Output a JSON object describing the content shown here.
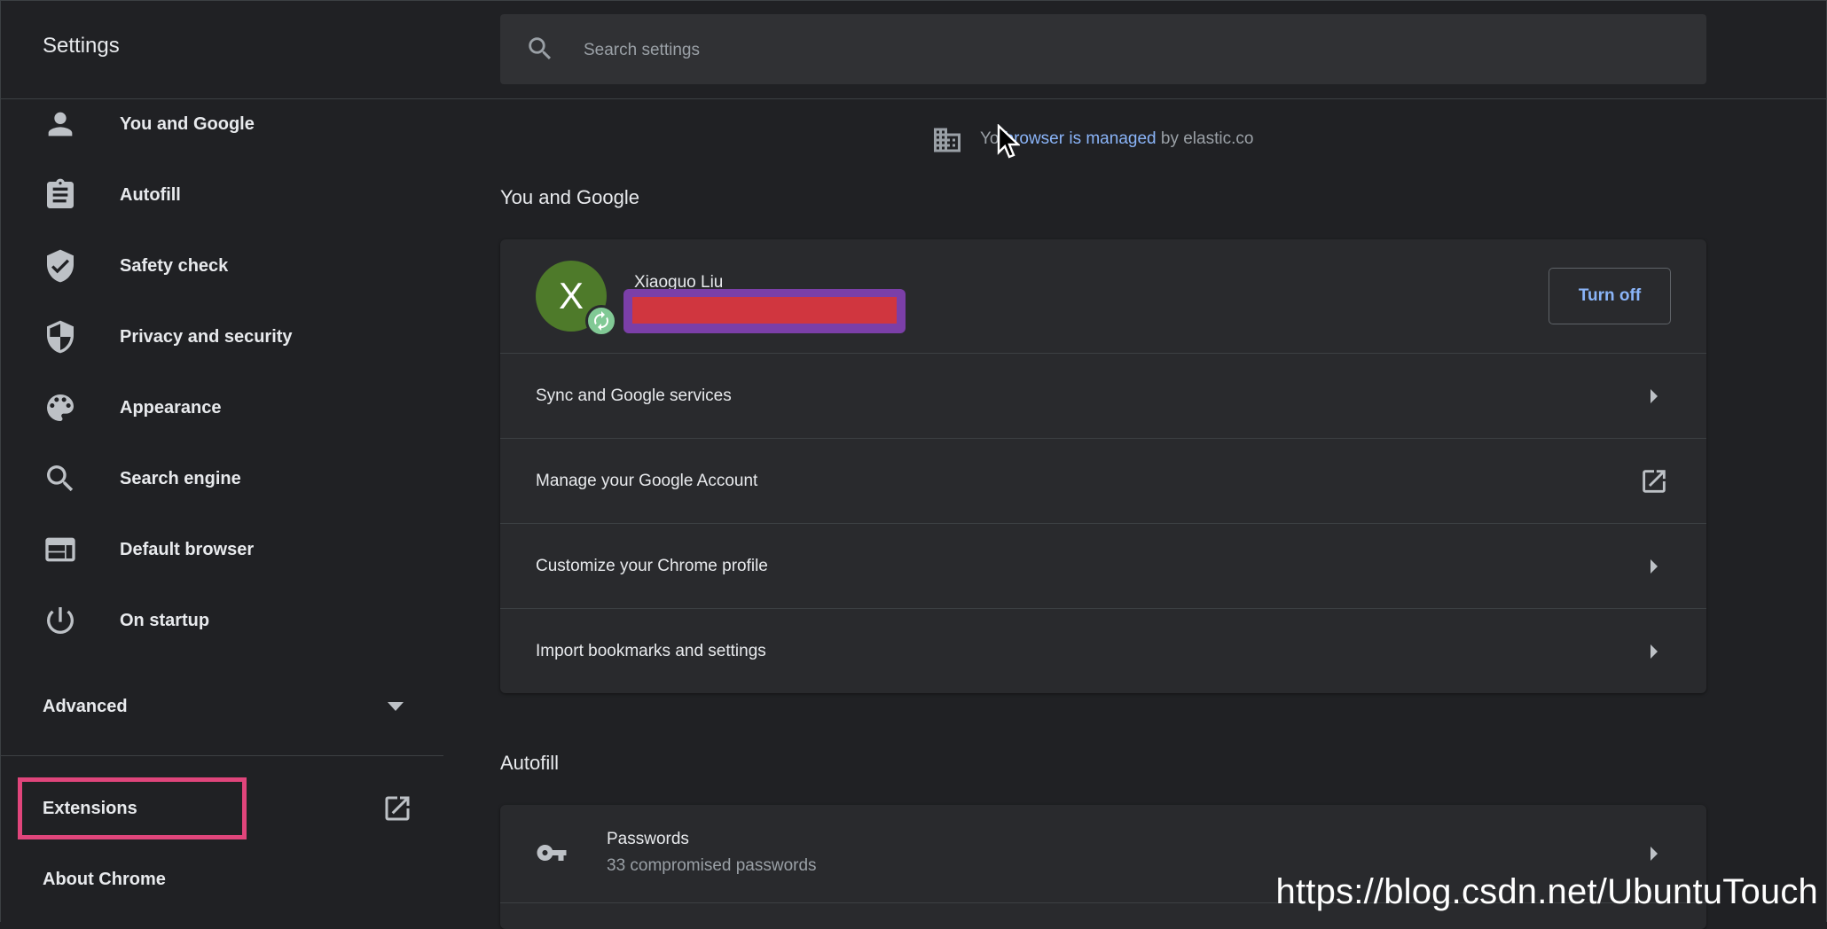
{
  "app": {
    "title": "Settings"
  },
  "search": {
    "placeholder": "Search settings"
  },
  "sidebar": {
    "items": [
      {
        "label": "You and Google",
        "icon": "person-icon"
      },
      {
        "label": "Autofill",
        "icon": "clipboard-icon"
      },
      {
        "label": "Safety check",
        "icon": "shield-check-icon"
      },
      {
        "label": "Privacy and security",
        "icon": "shield-icon"
      },
      {
        "label": "Appearance",
        "icon": "palette-icon"
      },
      {
        "label": "Search engine",
        "icon": "search-icon"
      },
      {
        "label": "Default browser",
        "icon": "browser-window-icon"
      },
      {
        "label": "On startup",
        "icon": "power-icon"
      }
    ],
    "advanced_label": "Advanced",
    "extensions_label": "Extensions",
    "about_label": "About Chrome"
  },
  "managed": {
    "prefix": "Yo",
    "link": "browser is managed",
    "suffix": " by elastic.co"
  },
  "you_and_google": {
    "title": "You and Google",
    "user_name": "Xiaoguo Liu",
    "avatar_letter": "X",
    "turn_off_label": "Turn off",
    "rows": [
      {
        "label": "Sync and Google services",
        "action": "arrow"
      },
      {
        "label": "Manage your Google Account",
        "action": "external"
      },
      {
        "label": "Customize your Chrome profile",
        "action": "arrow"
      },
      {
        "label": "Import bookmarks and settings",
        "action": "arrow"
      }
    ]
  },
  "autofill": {
    "title": "Autofill",
    "passwords_title": "Passwords",
    "passwords_subtitle": "33 compromised passwords"
  },
  "watermark": "https://blog.csdn.net/UbuntuTouch",
  "colors": {
    "background": "#202124",
    "card": "#292a2d",
    "accent": "#8ab4f8",
    "highlight": "#e0457b",
    "avatar": "#4e7a2a"
  }
}
